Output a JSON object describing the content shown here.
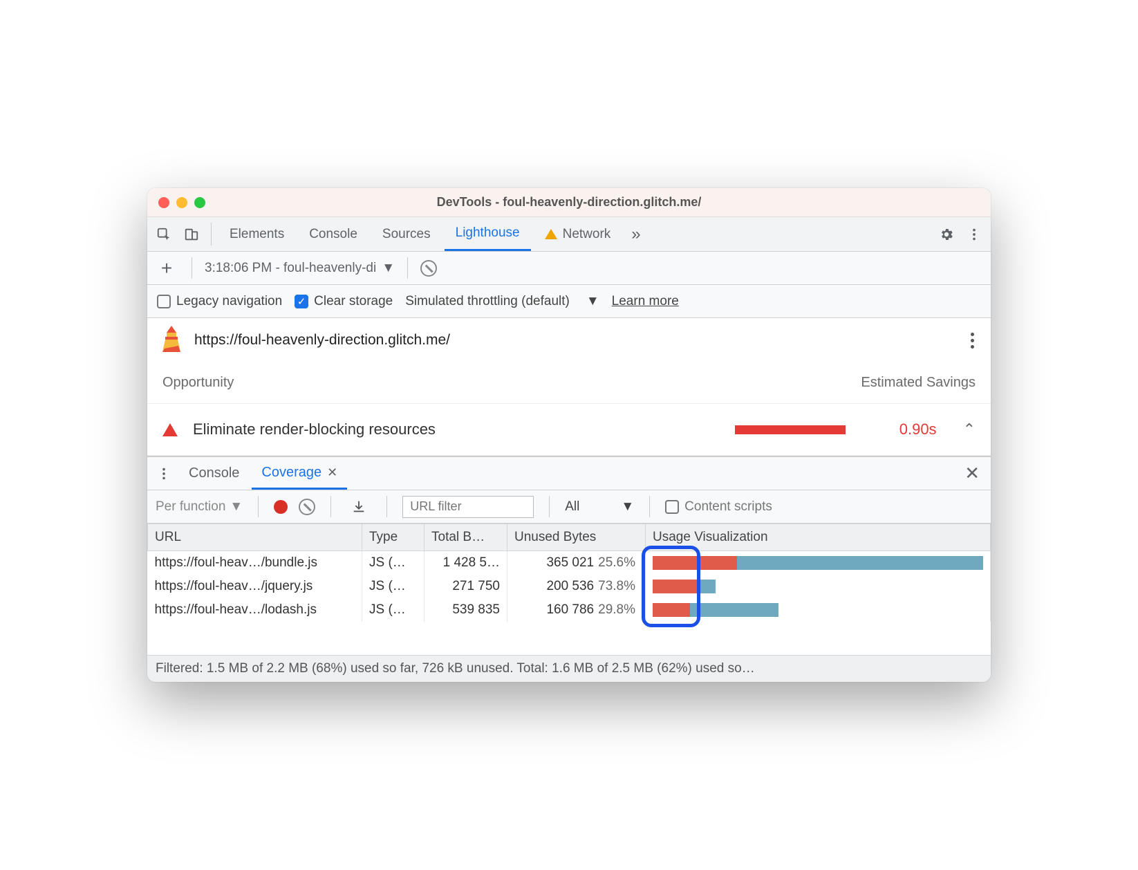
{
  "window": {
    "title": "DevTools - foul-heavenly-direction.glitch.me/"
  },
  "tabs": {
    "items": [
      "Elements",
      "Console",
      "Sources",
      "Lighthouse",
      "Network"
    ],
    "active": "Lighthouse",
    "network_has_warning": true
  },
  "runbar": {
    "run_label": "3:18:06 PM - foul-heavenly-di"
  },
  "options": {
    "legacy_label": "Legacy navigation",
    "legacy_checked": false,
    "clear_label": "Clear storage",
    "clear_checked": true,
    "throttling_label": "Simulated throttling (default)",
    "learn_more": "Learn more"
  },
  "lighthouse": {
    "url": "https://foul-heavenly-direction.glitch.me/",
    "headers": {
      "opportunity": "Opportunity",
      "savings": "Estimated Savings"
    },
    "item": {
      "title": "Eliminate render-blocking resources",
      "savings": "0.90s"
    }
  },
  "drawer": {
    "tabs": [
      "Console",
      "Coverage"
    ],
    "active": "Coverage"
  },
  "coverage_toolbar": {
    "granularity": "Per function",
    "filter_placeholder": "URL filter",
    "type_filter": "All",
    "content_scripts_label": "Content scripts",
    "content_scripts_checked": false
  },
  "coverage_table": {
    "columns": {
      "url": "URL",
      "type": "Type",
      "total": "Total B…",
      "unused": "Unused Bytes",
      "viz": "Usage Visualization"
    },
    "rows": [
      {
        "url": "https://foul-heav…/bundle.js",
        "type": "JS (…",
        "total": "1 428 5…",
        "unused_bytes": "365 021",
        "unused_pct": "25.6%",
        "viz_red": 25.6,
        "viz_blue": 74.4,
        "viz_scale": 1.0
      },
      {
        "url": "https://foul-heav…/jquery.js",
        "type": "JS (…",
        "total": "271 750",
        "unused_bytes": "200 536",
        "unused_pct": "73.8%",
        "viz_red": 73.8,
        "viz_blue": 26.2,
        "viz_scale": 0.19
      },
      {
        "url": "https://foul-heav…/lodash.js",
        "type": "JS (…",
        "total": "539 835",
        "unused_bytes": "160 786",
        "unused_pct": "29.8%",
        "viz_red": 29.8,
        "viz_blue": 70.2,
        "viz_scale": 0.38
      }
    ]
  },
  "status": "Filtered: 1.5 MB of 2.2 MB (68%) used so far, 726 kB unused. Total: 1.6 MB of 2.5 MB (62%) used so…"
}
